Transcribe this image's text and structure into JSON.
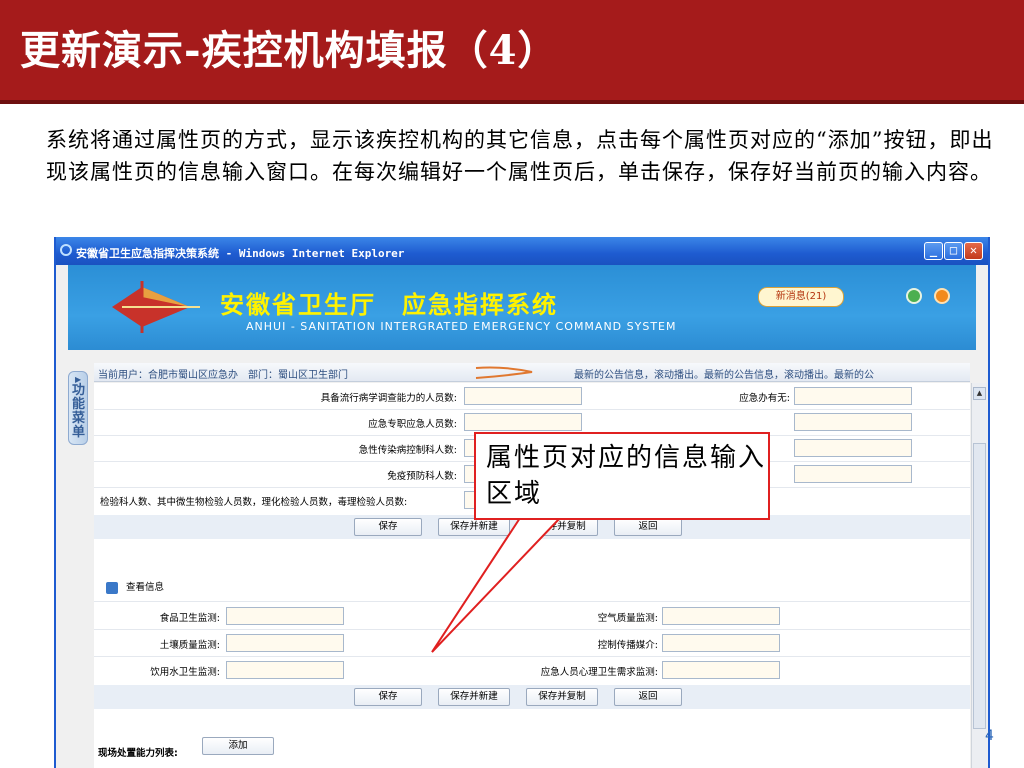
{
  "slide": {
    "title": "更新演示-疾控机构填报（4）",
    "description": "系统将通过属性页的方式，显示该疾控机构的其它信息，点击每个属性页对应的“添加”按钮，即出现该属性页的信息输入窗口。在每次编辑好一个属性页后，单击保存，保存好当前页的输入内容。",
    "page_number": "4"
  },
  "window": {
    "title": "安徽省卫生应急指挥决策系统 - Windows Internet Explorer",
    "controls": [
      "minimize-icon",
      "maximize-icon",
      "close-icon"
    ]
  },
  "app": {
    "title": "安徽省卫生厅　应急指挥系统",
    "subtitle": "ANHUI - SANITATION INTERGRATED EMERGENCY COMMAND SYSTEM",
    "new_messages": "新消息(21)",
    "left_menu": "功能菜单"
  },
  "userbar": {
    "current_user": "当前用户：合肥市蜀山区应急办　部门：蜀山区卫生部门",
    "notice": "最新的公告信息，滚动播出。最新的公告信息，滚动播出。最新的公"
  },
  "form1": {
    "rows": [
      {
        "label": "具备流行病学调查能力的人员数:",
        "right_label": "应急办有无:"
      },
      {
        "label": "应急专职应急人员数:",
        "right_label": ""
      },
      {
        "label": "急性传染病控制科人数:",
        "right_label": ""
      },
      {
        "label": "免疫预防科人数:",
        "right_label": ""
      },
      {
        "label": "检验科人数、其中微生物检验人员数，理化检验人员数，毒理检验人员数:",
        "right_label": ""
      }
    ],
    "buttons": [
      "保存",
      "保存并新建",
      "保存并复制",
      "返回"
    ]
  },
  "form2": {
    "section_title": "查看信息",
    "rows": [
      {
        "left_label": "食品卫生监测:",
        "right_label": "空气质量监测:"
      },
      {
        "left_label": "土壤质量监测:",
        "right_label": "控制传播媒介:"
      },
      {
        "left_label": "饮用水卫生监测:",
        "right_label": "应急人员心理卫生需求监测:"
      }
    ],
    "buttons": [
      "保存",
      "保存并新建",
      "保存并复制",
      "返回"
    ]
  },
  "field_capacity": {
    "label": "现场处置能力列表:",
    "add_button": "添加"
  },
  "callout": {
    "text": "属性页对应的信息输入区域"
  }
}
